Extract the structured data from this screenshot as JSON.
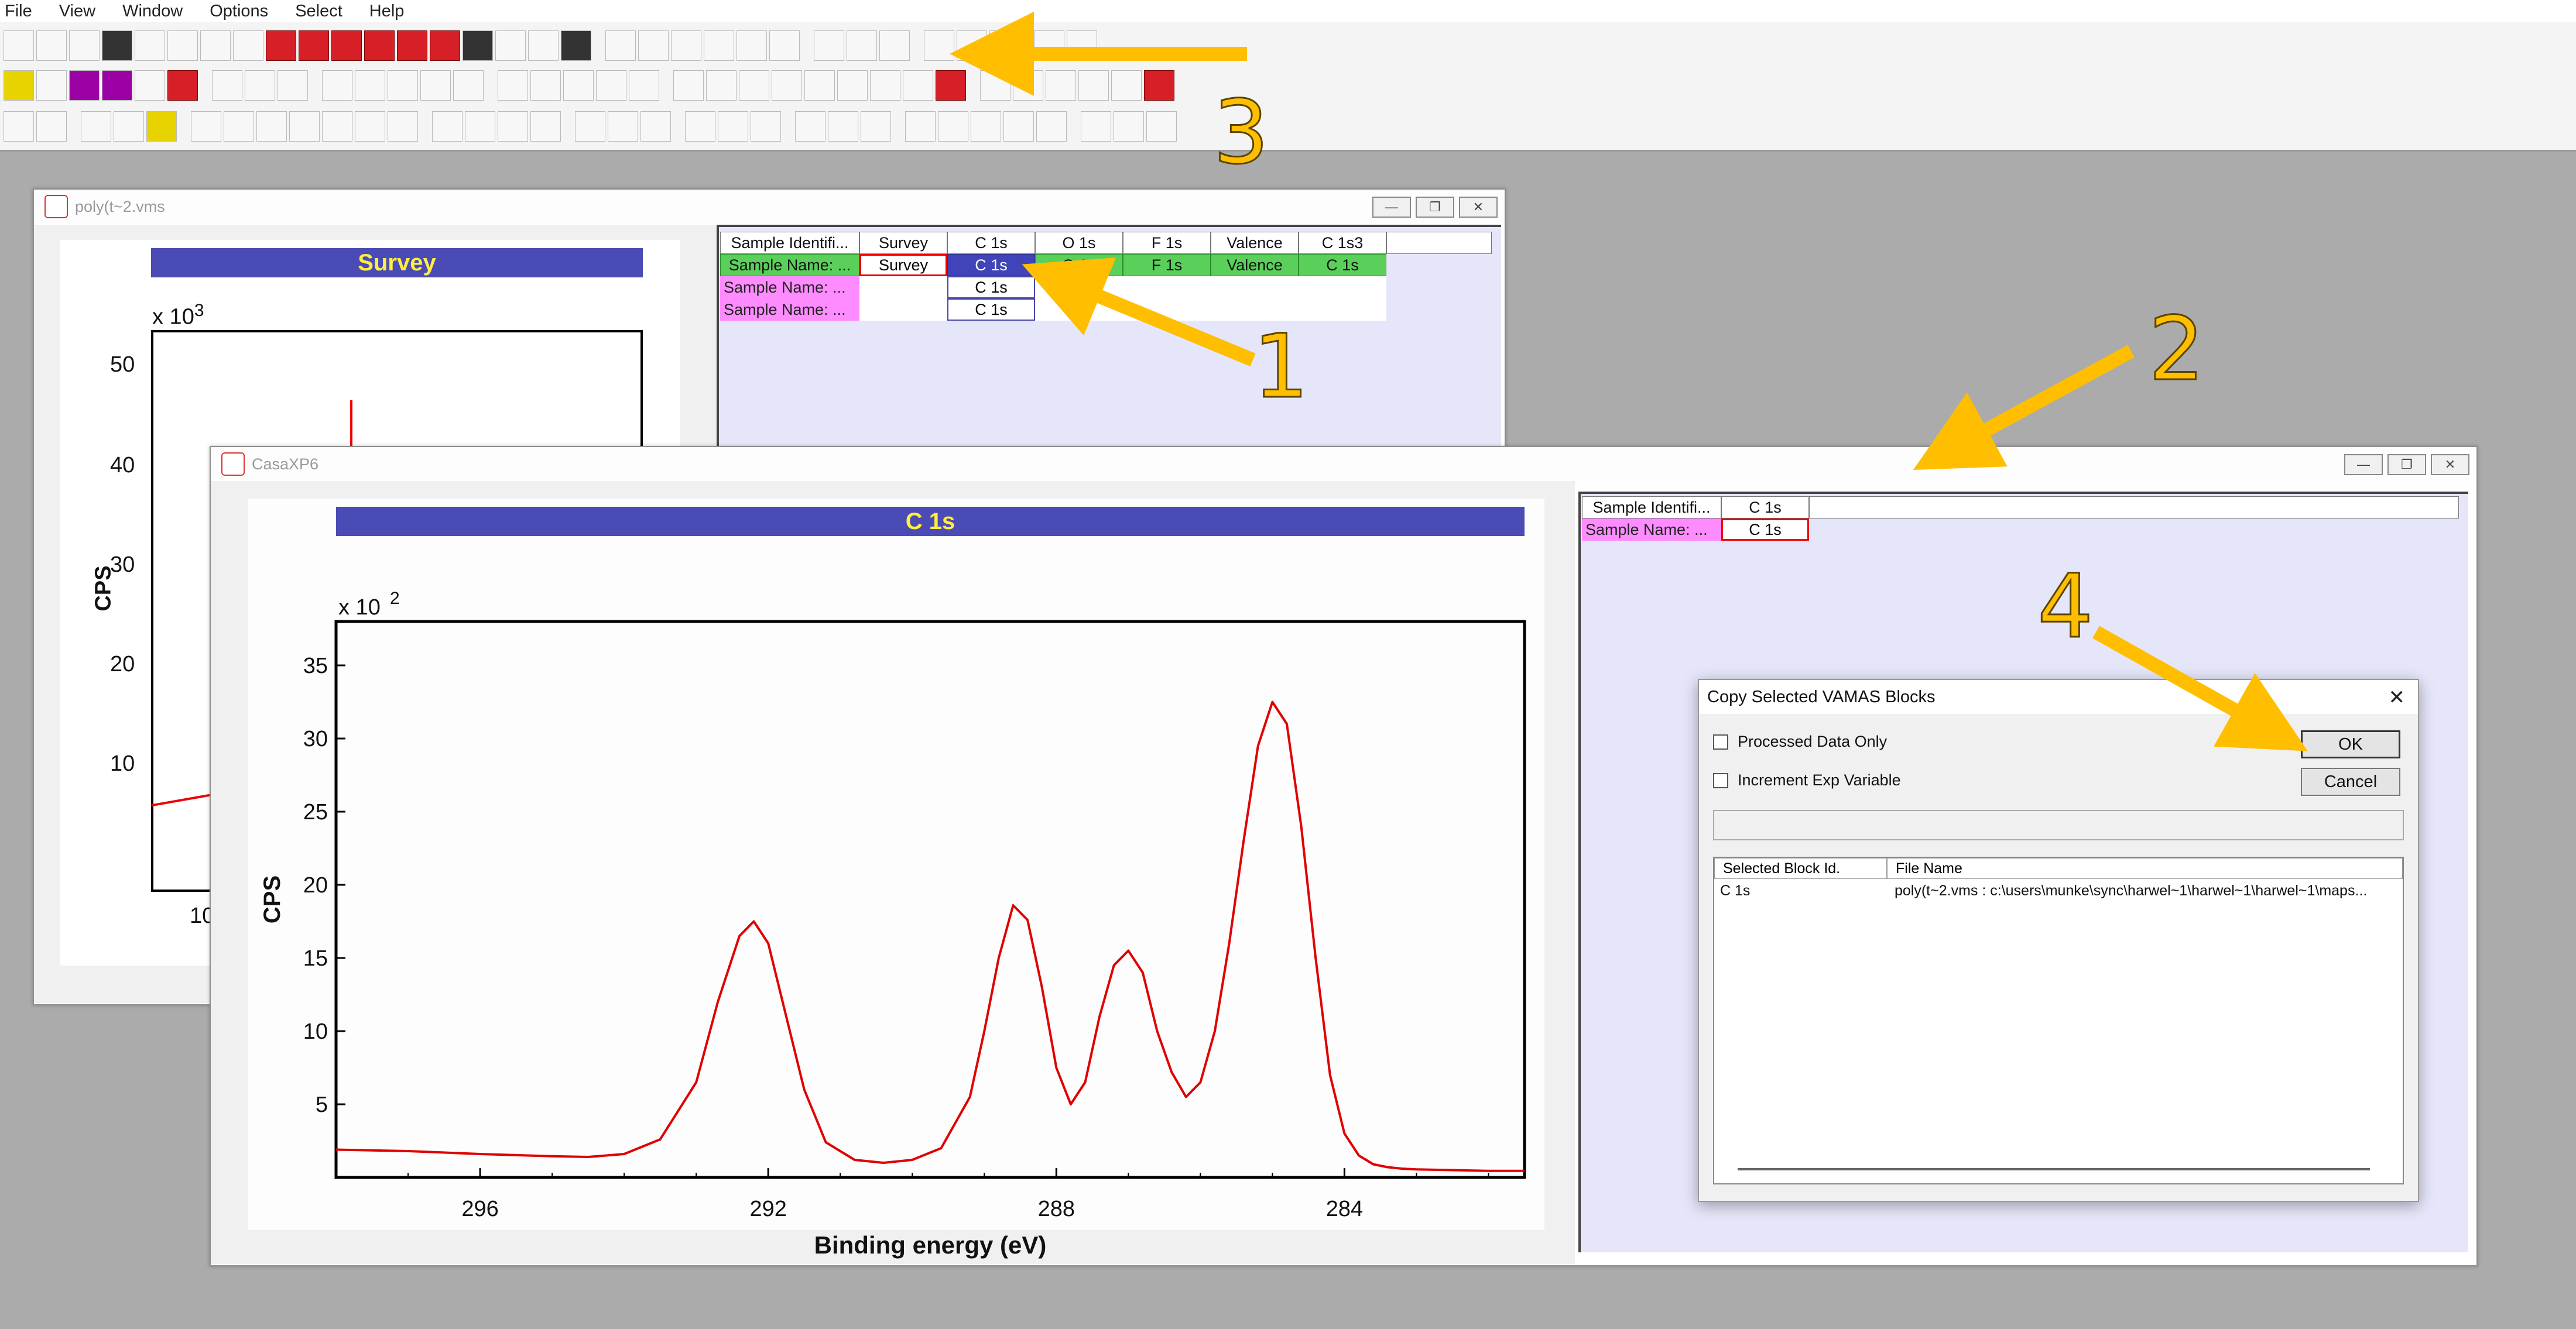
{
  "menu": [
    "File",
    "View",
    "Window",
    "Options",
    "Select",
    "Help"
  ],
  "window_back": {
    "title": "poly(t~2.vms",
    "plot_title": "Survey",
    "exponent_base": "x 10",
    "exponent_power": "3",
    "ylabel": "CPS",
    "y_ticks": [
      "50",
      "40",
      "30",
      "20",
      "10"
    ],
    "x_tick_partial": "10",
    "grid": {
      "headers": [
        "Sample Identifi...",
        "Survey",
        "C 1s",
        "O 1s",
        "F 1s",
        "Valence",
        "C 1s3"
      ],
      "row1": [
        "Sample Name: ...",
        "Survey",
        "C 1s",
        "O 1s",
        "F 1s",
        "Valence",
        "C 1s"
      ],
      "row2": [
        "Sample Name: ...",
        "",
        "C 1s"
      ],
      "row3": [
        "Sample Name: ...",
        "",
        "C 1s"
      ]
    }
  },
  "window_front": {
    "title": "CasaXP6",
    "grid": {
      "headers": [
        "Sample Identifi...",
        "C 1s"
      ],
      "row1": [
        "Sample Name: ...",
        "C 1s"
      ]
    }
  },
  "window_buttons": {
    "minimize": "—",
    "restore": "❐",
    "close": "✕"
  },
  "chart_data": {
    "type": "line",
    "title": "C 1s",
    "xlabel": "Binding energy (eV)",
    "ylabel": "CPS",
    "y_multiplier": "x 10",
    "y_multiplier_power": "2",
    "x_reversed": true,
    "xlim": [
      298.0,
      281.5
    ],
    "ylim": [
      0,
      38
    ],
    "x_ticks": [
      296,
      292,
      288,
      284
    ],
    "y_ticks": [
      5,
      10,
      15,
      20,
      25,
      30,
      35
    ],
    "grid": false,
    "series": [
      {
        "color": "#e00000",
        "x": [
          298.0,
          297.0,
          296.0,
          295.0,
          294.5,
          294.0,
          293.5,
          293.0,
          292.7,
          292.4,
          292.2,
          292.0,
          291.8,
          291.5,
          291.2,
          290.8,
          290.4,
          290.0,
          289.6,
          289.2,
          289.0,
          288.8,
          288.6,
          288.4,
          288.2,
          288.0,
          287.8,
          287.6,
          287.4,
          287.2,
          287.0,
          286.8,
          286.6,
          286.4,
          286.2,
          286.0,
          285.8,
          285.6,
          285.4,
          285.2,
          285.0,
          284.8,
          284.6,
          284.4,
          284.2,
          284.0,
          283.8,
          283.6,
          283.4,
          283.2,
          283.0,
          282.5,
          282.0,
          281.5
        ],
        "y": [
          1.9,
          1.8,
          1.6,
          1.45,
          1.4,
          1.6,
          2.6,
          6.5,
          12,
          16.5,
          17.5,
          16,
          12,
          6,
          2.4,
          1.2,
          1.0,
          1.2,
          2.0,
          5.5,
          10,
          15,
          18.6,
          17.6,
          13,
          7.5,
          5.0,
          6.5,
          11,
          14.5,
          15.5,
          14,
          10,
          7.2,
          5.5,
          6.5,
          10,
          16,
          23,
          29.5,
          32.5,
          31,
          24,
          15,
          7,
          3.0,
          1.5,
          0.9,
          0.7,
          0.6,
          0.55,
          0.5,
          0.45,
          0.45
        ]
      }
    ]
  },
  "dialog": {
    "title": "Copy Selected VAMAS Blocks",
    "close": "✕",
    "checkbox1": "Processed Data Only",
    "checkbox2": "Increment Exp Variable",
    "ok": "OK",
    "cancel": "Cancel",
    "list_headers": [
      "Selected Block Id.",
      "File Name"
    ],
    "list_row": [
      "C 1s",
      "poly(t~2.vms : c:\\users\\munke\\sync\\harwel~1\\harwel~1\\harwel~1\\maps..."
    ]
  },
  "annotations": [
    "1",
    "2",
    "3",
    "4"
  ],
  "colors": {
    "arrow": "#ffbf00",
    "plot_title_bg": "#4b4bb5",
    "plot_title_text": "#ffef40",
    "curve": "#e00000"
  }
}
